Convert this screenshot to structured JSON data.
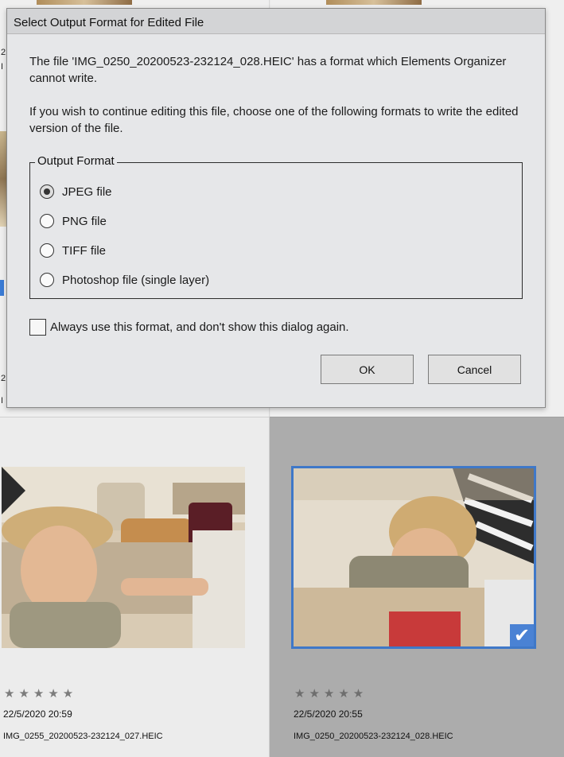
{
  "dialog": {
    "title": "Select Output Format for Edited File",
    "message_line1": "The file 'IMG_0250_20200523-232124_028.HEIC' has a format which Elements Organizer cannot write.",
    "message_line2": "If you wish to continue editing this file, choose one of the following formats to write the edited version of the file.",
    "group_label": "Output Format",
    "options": [
      {
        "label": "JPEG file",
        "selected": true
      },
      {
        "label": "PNG file",
        "selected": false
      },
      {
        "label": "TIFF file",
        "selected": false
      },
      {
        "label": "Photoshop file (single layer)",
        "selected": false
      }
    ],
    "checkbox_label": "Always use this format, and don't show this dialog again.",
    "checkbox_checked": false,
    "ok_label": "OK",
    "cancel_label": "Cancel"
  },
  "grid": {
    "stubs": {
      "a": "2",
      "b": "I",
      "c": "2",
      "d": "I"
    },
    "items": [
      {
        "date": "22/5/2020 20:59",
        "filename": "IMG_0255_20200523-232124_027.HEIC",
        "rating": 0,
        "selected": false,
        "stars": "★★★★★"
      },
      {
        "date": "22/5/2020 20:55",
        "filename": "IMG_0250_20200523-232124_028.HEIC",
        "rating": 0,
        "selected": true,
        "stars": "★★★★★"
      }
    ],
    "check_glyph": "✔"
  },
  "colors": {
    "selection_accent": "#3f78c8",
    "selected_cell_bg": "#acacac",
    "dialog_bg": "#e6e7e9"
  },
  "icons": {
    "selected_check": "checkmark-icon",
    "rating": "star-icon"
  }
}
